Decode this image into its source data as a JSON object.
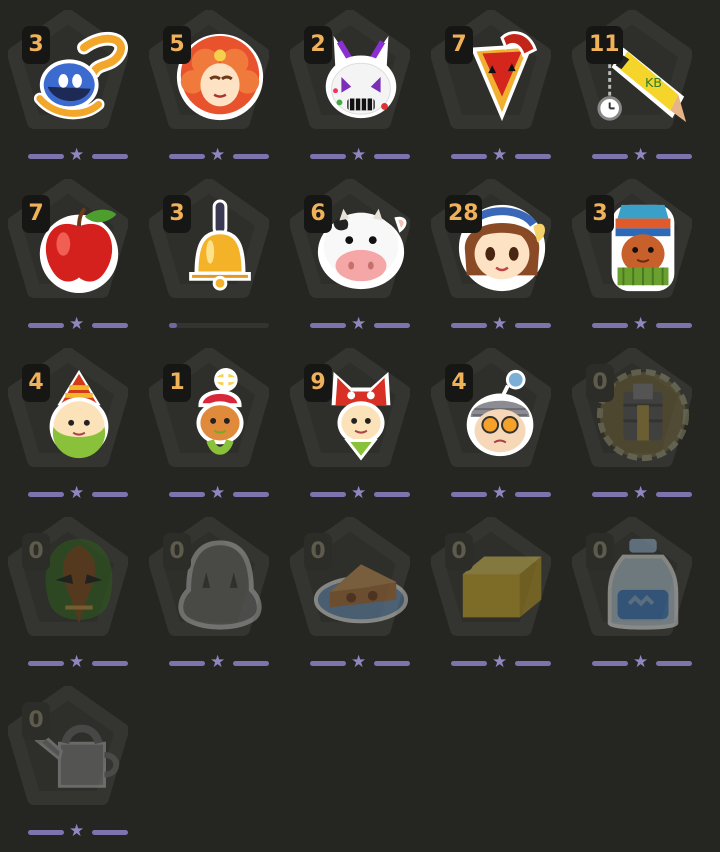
{
  "colors": {
    "background": "#252521",
    "count_text": "#f0b15b",
    "count_text_locked": "#5e5a4c",
    "star_bar": "#7d74ad"
  },
  "items": [
    {
      "count": "3",
      "icon": "blue-bird-icon",
      "stars": "full"
    },
    {
      "count": "5",
      "icon": "orange-haired-harvest-goddess-icon",
      "stars": "full"
    },
    {
      "count": "2",
      "icon": "white-rabbit-mask-icon",
      "stars": "full"
    },
    {
      "count": "7",
      "icon": "red-jester-icon",
      "stars": "full"
    },
    {
      "count": "11",
      "icon": "yellow-pencil-with-watch-icon",
      "stars": "full"
    },
    {
      "count": "7",
      "icon": "red-apple-icon",
      "stars": "full"
    },
    {
      "count": "3",
      "icon": "golden-bell-icon",
      "stars": "progress",
      "progress": 0.08
    },
    {
      "count": "6",
      "icon": "cow-icon",
      "stars": "full"
    },
    {
      "count": "28",
      "icon": "brown-haired-girl-icon",
      "stars": "full"
    },
    {
      "count": "3",
      "icon": "harvest-sprite-totem-icon",
      "stars": "full"
    },
    {
      "count": "4",
      "icon": "green-sprite-striped-hat-icon",
      "stars": "full"
    },
    {
      "count": "1",
      "icon": "flower-hat-sprite-icon",
      "stars": "full"
    },
    {
      "count": "9",
      "icon": "cat-hood-sprite-icon",
      "stars": "full"
    },
    {
      "count": "4",
      "icon": "goggles-sprite-icon",
      "stars": "full"
    },
    {
      "count": "0",
      "icon": "stone-gear-icon",
      "stars": "full",
      "locked": true
    },
    {
      "count": "0",
      "icon": "green-tribal-mask-icon",
      "stars": "full",
      "locked": true
    },
    {
      "count": "0",
      "icon": "shadow-blob-icon",
      "stars": "full",
      "locked": true
    },
    {
      "count": "0",
      "icon": "pie-on-plate-icon",
      "stars": "full",
      "locked": true
    },
    {
      "count": "0",
      "icon": "butter-block-icon",
      "stars": "full",
      "locked": true
    },
    {
      "count": "0",
      "icon": "milk-jar-icon",
      "stars": "full",
      "locked": true
    },
    {
      "count": "0",
      "icon": "watering-can-icon",
      "stars": "full",
      "locked": true
    }
  ]
}
